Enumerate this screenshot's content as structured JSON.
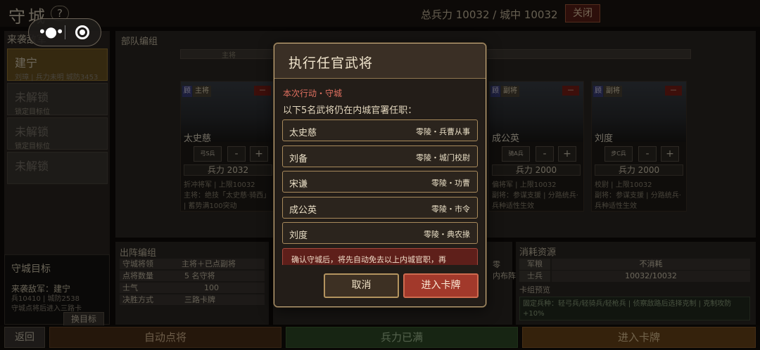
{
  "topbar": {
    "title": "守城",
    "help": "?",
    "troops_label": "总兵力  10032  /  城中  10032",
    "close": "关闭"
  },
  "mini_program": {
    "menu_icon": "more-dots-icon",
    "close_icon": "record-icon"
  },
  "left_panel": {
    "header": "来袭敌军",
    "slots": [
      {
        "name": "建宁",
        "sub": "刘璋 | 兵力未明 城防3453"
      },
      {
        "name": "未解锁",
        "sub": "锁定目标位"
      },
      {
        "name": "未解锁",
        "sub": "锁定目标位"
      },
      {
        "name": "未解锁",
        "sub": ""
      }
    ]
  },
  "goal_panel": {
    "title": "守城目标",
    "line1": "来袭敌军：建宁",
    "line2": "兵10410 | 城防2538",
    "line3": "守城点将后进入三路卡",
    "button": "换目标"
  },
  "main_panel": {
    "title": "部队编组",
    "bar_label": "主将"
  },
  "cards": [
    {
      "name": "太史慈",
      "badge": "顾",
      "role": "主将",
      "minus": "－",
      "unit": "弓S兵",
      "troops": "兵力 2032",
      "info1": "折冲将军 | 上限10032",
      "info2": "主将：绝技「太史慈·骑西」",
      "info3": "| 蓄势满100突动"
    },
    {
      "name": "成公英",
      "badge": "顾",
      "role": "副将",
      "minus": "－",
      "unit": "骑A兵",
      "troops": "兵力 2000",
      "info1": "偏将军 | 上限10032",
      "info2": "副将：参谋支援 | 分路统兵·",
      "info3": "兵种适性生效"
    },
    {
      "name": "刘度",
      "badge": "顾",
      "role": "副将",
      "minus": "－",
      "unit": "步C兵",
      "troops": "兵力 2000",
      "info1": "校尉 | 上限10032",
      "info2": "副将：参谋支援 | 分路统兵·",
      "info3": "兵种适性生效"
    }
  ],
  "deploy_panel": {
    "title": "出阵编组",
    "rows": [
      {
        "k": "守城将领",
        "v": "主将＋已点副将"
      },
      {
        "k": "点将数量",
        "v": "5 名守将"
      },
      {
        "k": "士气",
        "v": "100"
      },
      {
        "k": "决胜方式",
        "v": "三路卡牌"
      }
    ]
  },
  "mid_panel": {
    "line1": "零",
    "line2": "内布阵"
  },
  "consume_panel": {
    "title": "消耗资源",
    "rows": [
      {
        "k": "军粮",
        "v": "不消耗"
      },
      {
        "k": "士兵",
        "v": "10032/10032"
      }
    ],
    "preview_label": "卡组预览",
    "preview_text": "固定兵种：轻弓兵/轻骑兵/轻枪兵 | 侦察敌路后选择克制 | 克制攻防+10%"
  },
  "bottom": {
    "back": "返回",
    "auto": "自动点将",
    "full": "兵力已满",
    "enter": "进入卡牌"
  },
  "dialog": {
    "title": "执行任官武将",
    "tag": "本次行动・守城",
    "desc": "以下5名武将仍在内城官署任职：",
    "generals": [
      {
        "name": "太史慈",
        "post": "零陵・兵曹从事"
      },
      {
        "name": "刘备",
        "post": "零陵・城门校尉"
      },
      {
        "name": "宋谦",
        "post": "零陵・功曹"
      },
      {
        "name": "成公英",
        "post": "零陵・市令"
      },
      {
        "name": "刘度",
        "post": "零陵・典农掾"
      }
    ],
    "warning": "确认守城后，将先自动免去以上内城官职，再",
    "cancel": "取消",
    "confirm": "进入卡牌"
  }
}
